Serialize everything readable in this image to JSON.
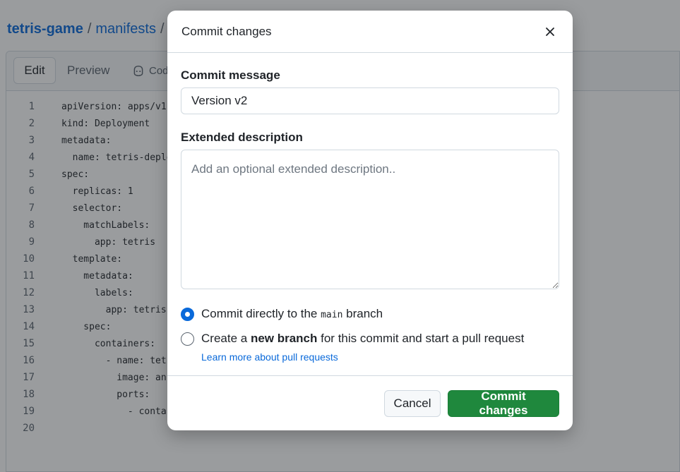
{
  "breadcrumb": {
    "repo": "tetris-game",
    "sep1": "/",
    "folder": "manifests",
    "sep2": "/"
  },
  "editor": {
    "tabs": {
      "edit": "Edit",
      "preview": "Preview",
      "copilot": "Cod"
    },
    "lines": [
      {
        "n": "1",
        "text": "apiVersion: apps/v1"
      },
      {
        "n": "2",
        "text": "kind: Deployment"
      },
      {
        "n": "3",
        "text": "metadata:"
      },
      {
        "n": "4",
        "text": "  name: tetris-deplo"
      },
      {
        "n": "5",
        "text": "spec:"
      },
      {
        "n": "6",
        "text": "  replicas: 1"
      },
      {
        "n": "7",
        "text": "  selector:"
      },
      {
        "n": "8",
        "text": "    matchLabels:"
      },
      {
        "n": "9",
        "text": "      app: tetris"
      },
      {
        "n": "10",
        "text": "  template:"
      },
      {
        "n": "11",
        "text": "    metadata:"
      },
      {
        "n": "12",
        "text": "      labels:"
      },
      {
        "n": "13",
        "text": "        app: tetris"
      },
      {
        "n": "14",
        "text": "    spec:"
      },
      {
        "n": "15",
        "text": "      containers:"
      },
      {
        "n": "16",
        "text": "        - name: tetr"
      },
      {
        "n": "17",
        "text": "          image: an"
      },
      {
        "n": "18",
        "text": "          ports:"
      },
      {
        "n": "19",
        "text": "            - conta"
      },
      {
        "n": "20",
        "text": ""
      }
    ]
  },
  "modal": {
    "title": "Commit changes",
    "commit_message_label": "Commit message",
    "commit_message_value": "Version v2",
    "extended_label": "Extended description",
    "extended_placeholder": "Add an optional extended description..",
    "option_direct": {
      "prefix": "Commit directly to the ",
      "branch": "main",
      "suffix": " branch",
      "checked": true
    },
    "option_new_branch": {
      "prefix": "Create a ",
      "bold": "new branch",
      "suffix": " for this commit and start a pull request",
      "checked": false
    },
    "learn_more": "Learn more about pull requests",
    "cancel_label": "Cancel",
    "commit_label": "Commit changes"
  },
  "colors": {
    "accent": "#0969da",
    "primary_button": "#1f883d",
    "link": "#0969da"
  },
  "icons": {
    "close": "close-icon",
    "copilot": "copilot-icon"
  }
}
